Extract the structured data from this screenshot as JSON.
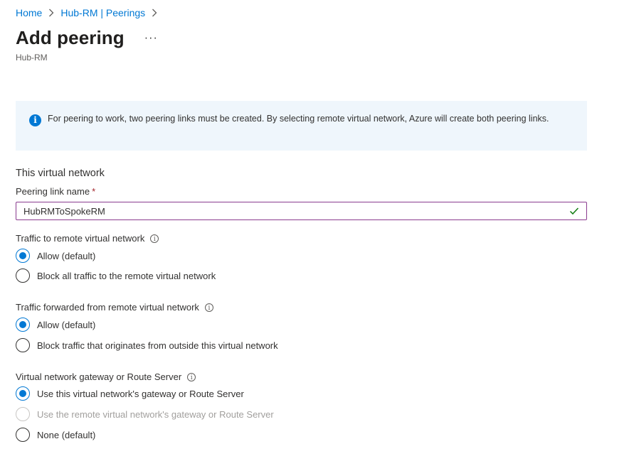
{
  "breadcrumb": {
    "home": "Home",
    "parent": "Hub-RM | Peerings"
  },
  "header": {
    "title": "Add peering",
    "more": "···",
    "subtitle": "Hub-RM"
  },
  "info": {
    "text": "For peering to work, two peering links must be created. By selecting remote virtual network, Azure will create both peering links."
  },
  "form": {
    "section_title": "This virtual network",
    "peering_link_label": "Peering link name",
    "required_mark": "*",
    "peering_link_value": "HubRMToSpokeRM",
    "traffic_to_remote": {
      "label": "Traffic to remote virtual network",
      "options": [
        "Allow (default)",
        "Block all traffic to the remote virtual network"
      ],
      "selected": "Allow (default)"
    },
    "traffic_forwarded": {
      "label": "Traffic forwarded from remote virtual network",
      "options": [
        "Allow (default)",
        "Block traffic that originates from outside this virtual network"
      ],
      "selected": "Allow (default)"
    },
    "gateway": {
      "label": "Virtual network gateway or Route Server",
      "options": [
        "Use this virtual network's gateway or Route Server",
        "Use the remote virtual network's gateway or Route Server",
        "None (default)"
      ],
      "selected": "Use this virtual network's gateway or Route Server",
      "disabled": [
        "Use the remote virtual network's gateway or Route Server"
      ]
    }
  },
  "colors": {
    "accent": "#0078d4",
    "input_border": "#8a3b8f",
    "valid_check": "#107c10",
    "info_background": "#eff6fc"
  }
}
